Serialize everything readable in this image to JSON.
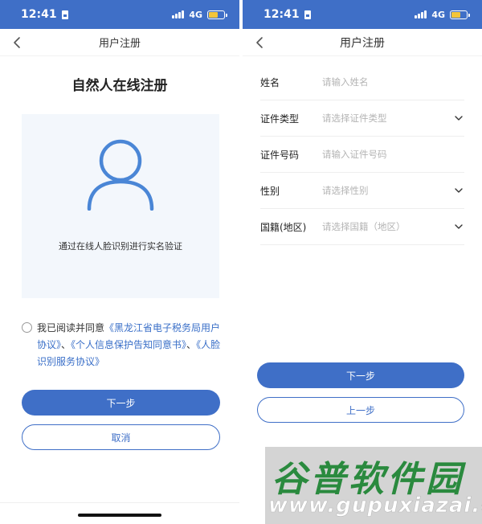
{
  "status_bar": {
    "time": "12:41",
    "network": "4G"
  },
  "left": {
    "nav_title": "用户注册",
    "heading": "自然人在线注册",
    "face_caption": "通过在线人脸识别进行实名验证",
    "agreement": {
      "prefix": "我已阅读并同意",
      "link1": "《黑龙江省电子税务局用户协议》",
      "sep1": "、",
      "link2": "《个人信息保护告知同意书》",
      "sep2": "、",
      "link3": "《人脸识别服务协议》"
    },
    "next_label": "下一步",
    "cancel_label": "取消"
  },
  "right": {
    "nav_title": "用户注册",
    "fields": [
      {
        "label": "姓名",
        "placeholder": "请输入姓名",
        "dropdown": false
      },
      {
        "label": "证件类型",
        "placeholder": "请选择证件类型",
        "dropdown": true
      },
      {
        "label": "证件号码",
        "placeholder": "请输入证件号码",
        "dropdown": false
      },
      {
        "label": "性别",
        "placeholder": "请选择性别",
        "dropdown": true
      },
      {
        "label": "国籍(地区)",
        "placeholder": "请选择国籍（地区）",
        "dropdown": true
      }
    ],
    "next_label": "下一步",
    "prev_label": "上一步"
  },
  "watermark": {
    "title": "谷普软件园",
    "url": "www.gupuxiazai.com"
  },
  "colors": {
    "primary": "#3f6fc7",
    "link": "#3a6fc8",
    "face_panel": "#f3f7fc"
  },
  "icons": [
    "back-icon",
    "user-outline-icon",
    "radio-icon",
    "chevron-down-icon",
    "signal-icon",
    "battery-icon",
    "sim-icon"
  ]
}
